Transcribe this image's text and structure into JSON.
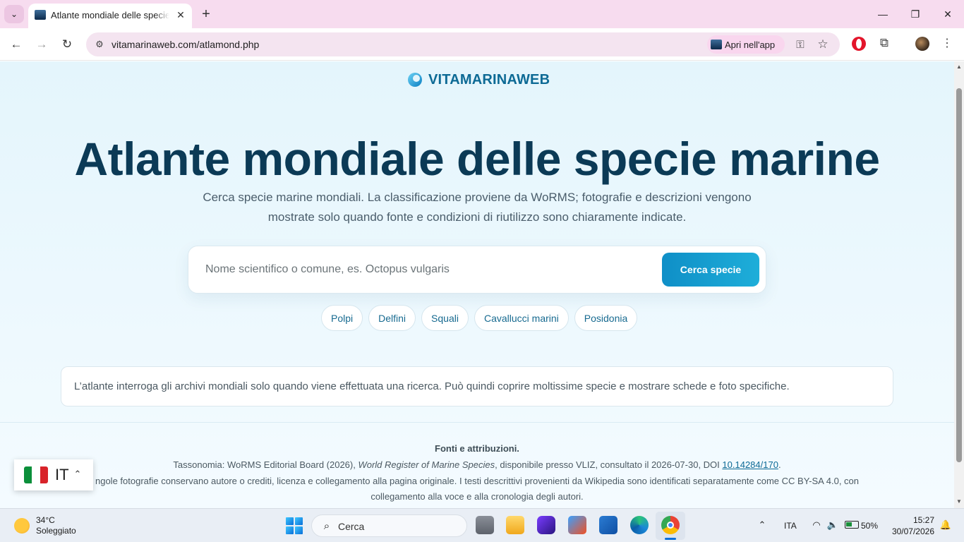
{
  "browser": {
    "tab_title": "Atlante mondiale delle specie marine",
    "tab_close_glyph": "✕",
    "new_tab_glyph": "+",
    "tab_list_glyph": "⌄",
    "url": "vitamarinaweb.com/atlamond.php",
    "open_in_app_label": "Apri nell'app",
    "window_controls": {
      "minimize": "—",
      "restore": "❐",
      "close": "✕"
    },
    "nav": {
      "back": "←",
      "forward": "→",
      "reload": "↻"
    },
    "icons": {
      "site_info": "site-info-icon",
      "key": "password-key-icon",
      "star": "bookmark-star-icon",
      "opera": "opera-extension-icon",
      "extensions": "extensions-puzzle-icon",
      "profile": "profile-avatar",
      "menu": "more-menu-icon"
    },
    "glyphs": {
      "site_info": "⚙",
      "key": "⚿",
      "star": "☆",
      "extensions": "⧉",
      "menu": "⋮"
    }
  },
  "site": {
    "brand_name": "VITAMARINAWEB",
    "hero": {
      "title": "Atlante mondiale delle specie marine",
      "subtitle": "Cerca specie marine mondiali. La classificazione proviene da WoRMS; fotografie e descrizioni vengono mostrate solo quando fonte e condizioni di riutilizzo sono chiaramente indicate."
    },
    "search": {
      "value": "",
      "placeholder": "Nome scientifico o comune, es. Octopus vulgaris",
      "button_label": "Cerca specie"
    },
    "chips": [
      "Polpi",
      "Delfini",
      "Squali",
      "Cavallucci marini",
      "Posidonia"
    ],
    "info_text": "L’atlante interroga gli archivi mondiali solo quando viene effettuata una ricerca. Può quindi coprire moltissime specie e mostrare schede e foto specifiche.",
    "footer": {
      "title": "Fonti e attribuzioni.",
      "taxonomy_prefix": "Tassonomia: WoRMS Editorial Board (2026), ",
      "taxonomy_work": "World Register of Marine Species",
      "taxonomy_mid": ", disponibile presso VLIZ, consultato il 2026-07-30, DOI ",
      "taxonomy_doi": "10.14284/170",
      "taxonomy_suffix": ".",
      "photos_line1": "ngole fotografie conservano autore o crediti, licenza e collegamento alla pagina originale. I testi descrittivi provenienti da Wikipedia sono identificati separatamente come CC BY-SA 4.0, con",
      "photos_line2": "collegamento alla voce e alla cronologia degli autori."
    },
    "language": {
      "code": "IT",
      "caret": "⌃",
      "flag_colors": [
        "#0b8f3a",
        "#ffffff",
        "#d8232a"
      ]
    },
    "colors": {
      "brand": "#0d6a95",
      "title": "#0b3a56",
      "button": "#1199cf"
    }
  },
  "taskbar": {
    "weather_temp": "34°C",
    "weather_desc": "Soleggiato",
    "search_label": "Cerca",
    "search_glyph": "⌕",
    "tray_chevron": "⌃",
    "language": "ITA",
    "wifi_glyph": "◠",
    "volume_glyph": "🔈",
    "battery_percent": "50%",
    "time": "15:27",
    "date": "30/07/2026",
    "notification_glyph": "🔔"
  }
}
